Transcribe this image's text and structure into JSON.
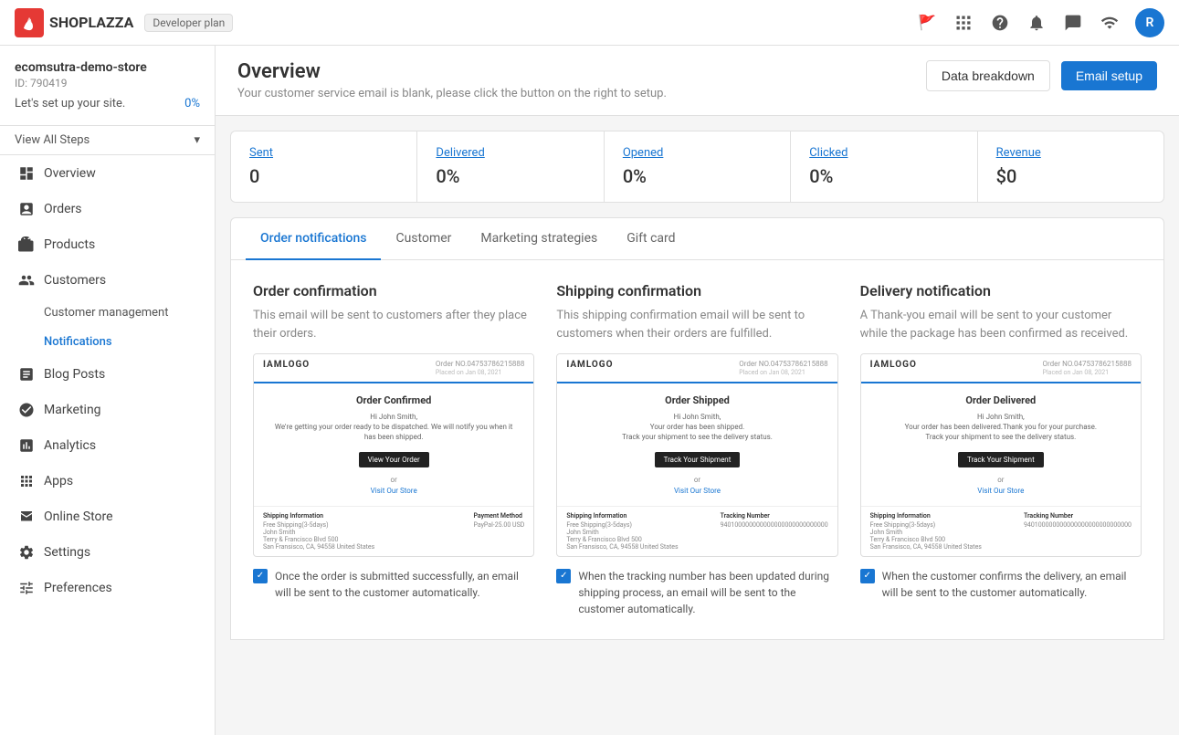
{
  "app": {
    "brand": "SHOPLAZZA",
    "plan_badge": "Developer plan"
  },
  "header": {
    "icons": [
      "flag-icon",
      "grid-icon",
      "help-icon",
      "bell-icon",
      "chat-icon",
      "wifi-icon"
    ],
    "avatar_initial": "R"
  },
  "sidebar": {
    "store_name": "ecomsutra-demo-store",
    "store_id": "ID: 790419",
    "setup_label": "Let's set up your site.",
    "setup_percent": "0%",
    "view_steps": "View All Steps",
    "nav": [
      {
        "id": "overview",
        "label": "Overview",
        "icon": "grid-icon"
      },
      {
        "id": "orders",
        "label": "Orders",
        "icon": "orders-icon"
      },
      {
        "id": "products",
        "label": "Products",
        "icon": "products-icon"
      },
      {
        "id": "customers",
        "label": "Customers",
        "icon": "customers-icon"
      },
      {
        "id": "customer-management",
        "label": "Customer management",
        "sub": true
      },
      {
        "id": "notifications",
        "label": "Notifications",
        "sub": true,
        "active": true
      },
      {
        "id": "blog-posts",
        "label": "Blog Posts",
        "icon": "blog-icon"
      },
      {
        "id": "marketing",
        "label": "Marketing",
        "icon": "marketing-icon"
      },
      {
        "id": "analytics",
        "label": "Analytics",
        "icon": "analytics-icon"
      },
      {
        "id": "apps",
        "label": "Apps",
        "icon": "apps-icon"
      },
      {
        "id": "online-store",
        "label": "Online Store",
        "icon": "store-icon"
      },
      {
        "id": "settings",
        "label": "Settings",
        "icon": "settings-icon"
      },
      {
        "id": "preferences",
        "label": "Preferences",
        "icon": "preferences-icon"
      }
    ]
  },
  "page": {
    "title": "Overview",
    "subtitle": "Your customer service email is blank, please click the button on the right to setup.",
    "btn_data_breakdown": "Data breakdown",
    "btn_email_setup": "Email setup"
  },
  "stats": [
    {
      "label": "Sent",
      "value": "0"
    },
    {
      "label": "Delivered",
      "value": "0%"
    },
    {
      "label": "Opened",
      "value": "0%"
    },
    {
      "label": "Clicked",
      "value": "0%"
    },
    {
      "label": "Revenue",
      "value": "$0"
    }
  ],
  "tabs": [
    {
      "id": "order-notifications",
      "label": "Order notifications",
      "active": true
    },
    {
      "id": "customer",
      "label": "Customer"
    },
    {
      "id": "marketing-strategies",
      "label": "Marketing strategies"
    },
    {
      "id": "gift-card",
      "label": "Gift card"
    }
  ],
  "cards": [
    {
      "id": "order-confirmation",
      "title": "Order confirmation",
      "desc": "This email will be sent to customers after they place their orders.",
      "email": {
        "logo": "IAMLOGO",
        "order_no": "Order NO.04753786215888",
        "email_title": "Order Confirmed",
        "greeting": "Hi John Smith,\nWe're getting your order ready to be dispatched. We will notify you when it has been shipped.",
        "btn_label": "View Your Order",
        "or_text": "or",
        "link_text": "Visit Our Store",
        "footer": [
          {
            "label": "Shipping Information",
            "value": "Free Shipping(3-5days)\nJohn Smith\nTerry & Francisco Blvd 500\nSan Fransisco, CA, 94558 United States"
          },
          {
            "label": "Payment Method",
            "value": "PayPal-25.00 USD"
          }
        ]
      },
      "checkbox_text": "Once the order is submitted successfully, an email will be sent to the customer automatically."
    },
    {
      "id": "shipping-confirmation",
      "title": "Shipping confirmation",
      "desc": "This shipping confirmation email will be sent to customers when their orders are fulfilled.",
      "email": {
        "logo": "IAMLOGO",
        "order_no": "Order NO.04753786215888",
        "email_title": "Order Shipped",
        "greeting": "Hi John Smith,\nYour order has been shipped.\nTrack your shipment to see the delivery status.",
        "btn_label": "Track Your Shipment",
        "or_text": "or",
        "link_text": "Visit Our Store",
        "footer": [
          {
            "label": "Shipping Information",
            "value": "Free Shipping(3-5days)\nJohn Smith\nTerry & Francisco Blvd 500\nSan Fransisco, CA, 94558 United States"
          },
          {
            "label": "Tracking Number",
            "value": "940100000000000000000000000000"
          }
        ]
      },
      "checkbox_text": "When the tracking number has been updated during shipping process, an email will be sent to the customer automatically."
    },
    {
      "id": "delivery-notification",
      "title": "Delivery notification",
      "desc": "A Thank-you email will be sent to your customer while the package has been confirmed as received.",
      "email": {
        "logo": "IAMLOGO",
        "order_no": "Order NO.04753786215888",
        "email_title": "Order Delivered",
        "greeting": "Hi John Smith,\nYour order has been delivered. Thank you for your purchase.\nTrack your shipment to see the delivery status.",
        "btn_label": "Track Your Shipment",
        "or_text": "or",
        "link_text": "Visit Our Store",
        "footer": [
          {
            "label": "Shipping Information",
            "value": "Free Shipping(3-5days)\nJohn Smith\nTerry & Francisco Blvd 500\nSan Fransisco, CA, 94558 United States"
          },
          {
            "label": "Tracking Number",
            "value": "940100000000000000000000000000"
          }
        ]
      },
      "checkbox_text": "When the customer confirms the delivery, an email will be sent to the customer automatically."
    }
  ]
}
